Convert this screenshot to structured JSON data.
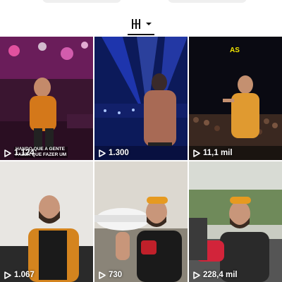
{
  "header": {
    "reels_tab_icon": "reels-grid-icon",
    "dropdown_icon": "caret-down-icon"
  },
  "reels": [
    {
      "views": "1.124",
      "caption": "HANDO QUE A GENTE\nFAZER QUE FAZER UM",
      "scene": "stage-crowd-pink"
    },
    {
      "views": "1.300",
      "scene": "stage-blue-lights"
    },
    {
      "views": "11,1 mil",
      "overlay": "AS",
      "scene": "outdoor-concert-night"
    },
    {
      "views": "1.067",
      "scene": "man-orange-shirt-sofa"
    },
    {
      "views": "730",
      "scene": "man-cap-airplane"
    },
    {
      "views": "228,4 mil",
      "scene": "man-cap-snack-bag"
    }
  ],
  "colors": {
    "view_text": "#ffffff",
    "tab_underline": "#111111"
  }
}
